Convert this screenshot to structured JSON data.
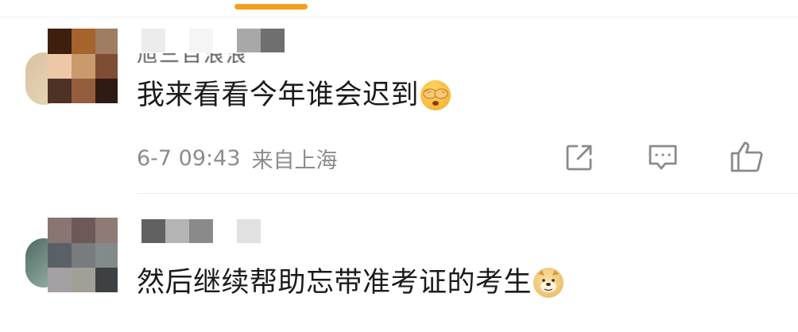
{
  "theme": {
    "accent": "#f2a01a",
    "mosaic_1": [
      "#3e1e0e",
      "#a6632c",
      "#a07c63",
      "#edc8a7",
      "#c99a6b",
      "#7e4d33",
      "#4e3225",
      "#945e3e",
      "#2f1a14"
    ],
    "mosaic_2": [
      "#877672",
      "#6c5a58",
      "#8f7b75",
      "#5a6166",
      "#787c7c",
      "#838a8a",
      "#a5a0a3",
      "#a29f97",
      "#3d4143"
    ],
    "name_blocks_1": [
      "#ececec",
      "#ffffff",
      "#f5f5f5",
      "#ffffff",
      "#a8a8a8",
      "#6f6f6f"
    ],
    "name_blocks_2": [
      "#616161",
      "#b4b4b4",
      "#8a8a8a",
      "#ffffff",
      "#e1e1e1"
    ]
  },
  "comments": [
    {
      "username_ghost": "旭三百浪浪",
      "text": "我来看看今年谁会迟到",
      "emoji": "covering-eyes-emoji",
      "timestamp": "6-7 09:43",
      "location": "来自上海",
      "actions": [
        "share-icon",
        "reply-icon",
        "like-icon"
      ]
    },
    {
      "text": "然后继续帮助忘带准考证的考生",
      "emoji": "doge-emoji"
    }
  ]
}
